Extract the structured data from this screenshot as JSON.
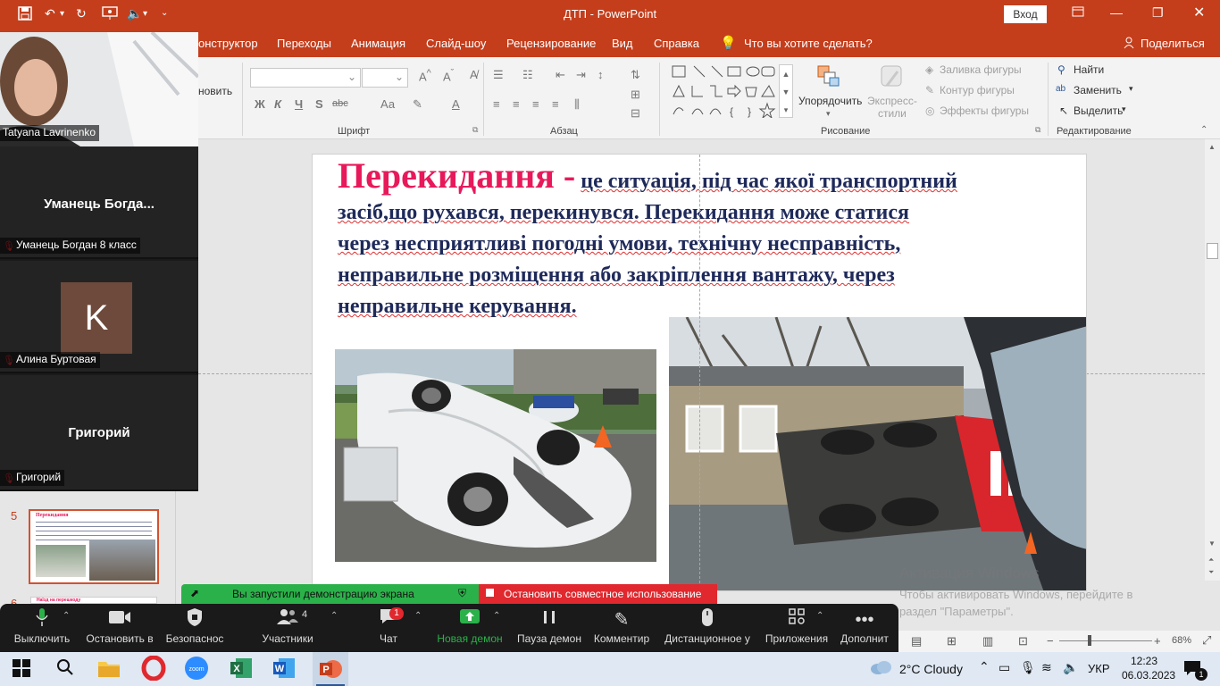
{
  "titlebar": {
    "title": "ДТП  -  PowerPoint",
    "signin": "Вход"
  },
  "tabs": [
    "онструктор",
    "Переходы",
    "Анимация",
    "Слайд-шоу",
    "Рецензирование",
    "Вид",
    "Справка"
  ],
  "tell_me": "Что вы хотите сделать?",
  "share": "Поделиться",
  "ribbon": {
    "partial_left": "новить",
    "font_group": "Шрифт",
    "paragraph_group": "Абзац",
    "drawing_group": "Рисование",
    "editing_group": "Редактирование",
    "arrange": "Упорядочить",
    "express_styles": "Экспресс-\nстили",
    "shape_fill": "Заливка фигуры",
    "shape_outline": "Контур фигуры",
    "shape_effects": "Эффекты фигуры",
    "find": "Найти",
    "replace": "Заменить",
    "select": "Выделить",
    "font_bold": "Ж",
    "font_italic": "К",
    "font_underline": "Ч",
    "font_strike": "S",
    "font_spacing": "abc",
    "font_case": "Аа"
  },
  "slide": {
    "title": "Перекидання -",
    "body": [
      "це ситуація, під час якої транспортний",
      "засіб,що рухався, перекинувся. Перекидання може статися",
      "через несприятливі погодні умови, технічну несправність,",
      "неправильне розміщення або закріплення вантажу, через",
      "неправильне керування."
    ]
  },
  "thumbnails": {
    "current_num": "5",
    "next_num": "6",
    "preview_title": "Перекидання",
    "preview_next": "Наїзд на перешкоду"
  },
  "zoom": {
    "participants": [
      {
        "name": "Tatyana Lavrinenko",
        "display": ""
      },
      {
        "name": "Уманець Богдан 8 класс",
        "display": "Уманець  Богда..."
      },
      {
        "name": "Алина Буртовая",
        "display": "",
        "initial": "K"
      },
      {
        "name": "Григорий",
        "display": "Григорий"
      }
    ],
    "share_notice": "Вы запустили демонстрацию экрана",
    "stop_share": "Остановить совместное использование",
    "toolbar": [
      {
        "label": "Выключить",
        "icon": "microphone-icon"
      },
      {
        "label": "Остановить в",
        "icon": "video-camera-icon"
      },
      {
        "label": "Безопаснос",
        "icon": "shield-icon"
      },
      {
        "label": "Участники",
        "icon": "participants-icon",
        "count": "4"
      },
      {
        "label": "Чат",
        "icon": "chat-icon",
        "badge": "1"
      },
      {
        "label": "Новая демон",
        "icon": "share-screen-icon"
      },
      {
        "label": "Пауза демон",
        "icon": "pause-icon"
      },
      {
        "label": "Комментир",
        "icon": "pen-icon"
      },
      {
        "label": "Дистанционное у",
        "icon": "mouse-icon"
      },
      {
        "label": "Приложения",
        "icon": "apps-icon"
      },
      {
        "label": "Дополнит",
        "icon": "more-icon"
      }
    ]
  },
  "activation": {
    "title": "Активация Windows",
    "text1": "Чтобы активировать Windows, перейдите в",
    "text2": "раздел \"Параметры\"."
  },
  "statusbar": {
    "zoom": "68%",
    "minus": "−",
    "plus": "+"
  },
  "taskbar": {
    "weather": "2°C  Cloudy",
    "lang": "УКР",
    "time": "12:23",
    "date": "06.03.2023",
    "notifications": "1"
  },
  "colors": {
    "ppt_accent": "#c43e1c",
    "title_pink": "#e8195b",
    "body_navy": "#1f2a5a",
    "share_green": "#2bb14a",
    "stop_red": "#e0282e"
  }
}
